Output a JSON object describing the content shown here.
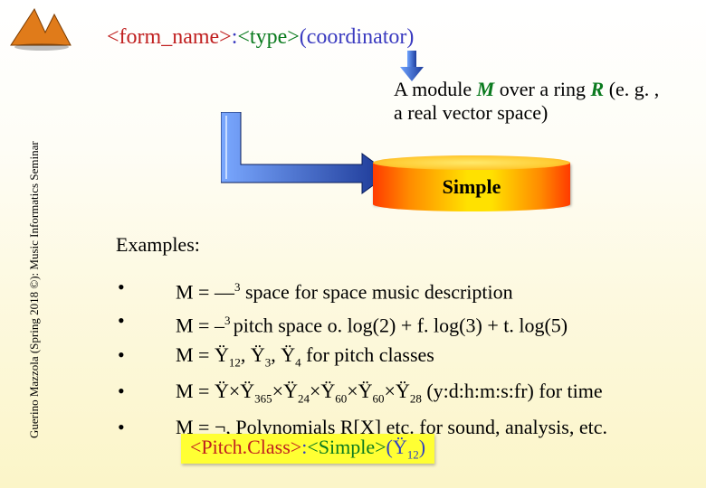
{
  "sidebar": {
    "text": "Guerino Mazzola (Spring 2018 ©): Music Informatics Seminar"
  },
  "title": {
    "seg": [
      {
        "t": "<form_name>",
        "c": "#c02020"
      },
      {
        "t": ":",
        "c": "#3b3bc0"
      },
      {
        "t": "<type>",
        "c": "#0a7a1e"
      },
      {
        "t": "(coordinator)",
        "c": "#3b3bc0"
      }
    ]
  },
  "body": {
    "pre": "A module ",
    "M": "M",
    "mid": " over a ring ",
    "R": "R",
    "post": " (e. g. , a real vector space)"
  },
  "cylinder_label": "Simple",
  "examples_heading": "Examples:",
  "examples": [
    {
      "html": "M =  —<sup>3</sup> space for space music description"
    },
    {
      "html": "M = –<sup>3 </sup>pitch space o. log(2) + f. log(3) + t. log(5)"
    },
    {
      "html": "M = Ÿ<sub>12</sub>, Ÿ<sub>3</sub>, Ÿ<sub>4</sub> for pitch classes"
    },
    {
      "html": "M = Ÿ×Ÿ<sub>365</sub>×Ÿ<sub>24</sub>×Ÿ<sub>60</sub>×Ÿ<sub>60</sub>×Ÿ<sub>28</sub> (y:d:h:m:s:fr) for time"
    },
    {
      "html": "M = ¬,  Polynomials R[X] etc. for sound, analysis, etc."
    }
  ],
  "pitchclass": {
    "seg": [
      {
        "t": "<Pitch.Class>",
        "c": "#c02020"
      },
      {
        "t": ":",
        "c": "#3040c0"
      },
      {
        "t": "<Simple>",
        "c": "#0a7a1e"
      },
      {
        "t": "(Ÿ",
        "c": "#3040c0"
      },
      {
        "t": "12",
        "c": "#3040c0",
        "sub": true
      },
      {
        "t": ")",
        "c": "#3040c0"
      }
    ]
  }
}
